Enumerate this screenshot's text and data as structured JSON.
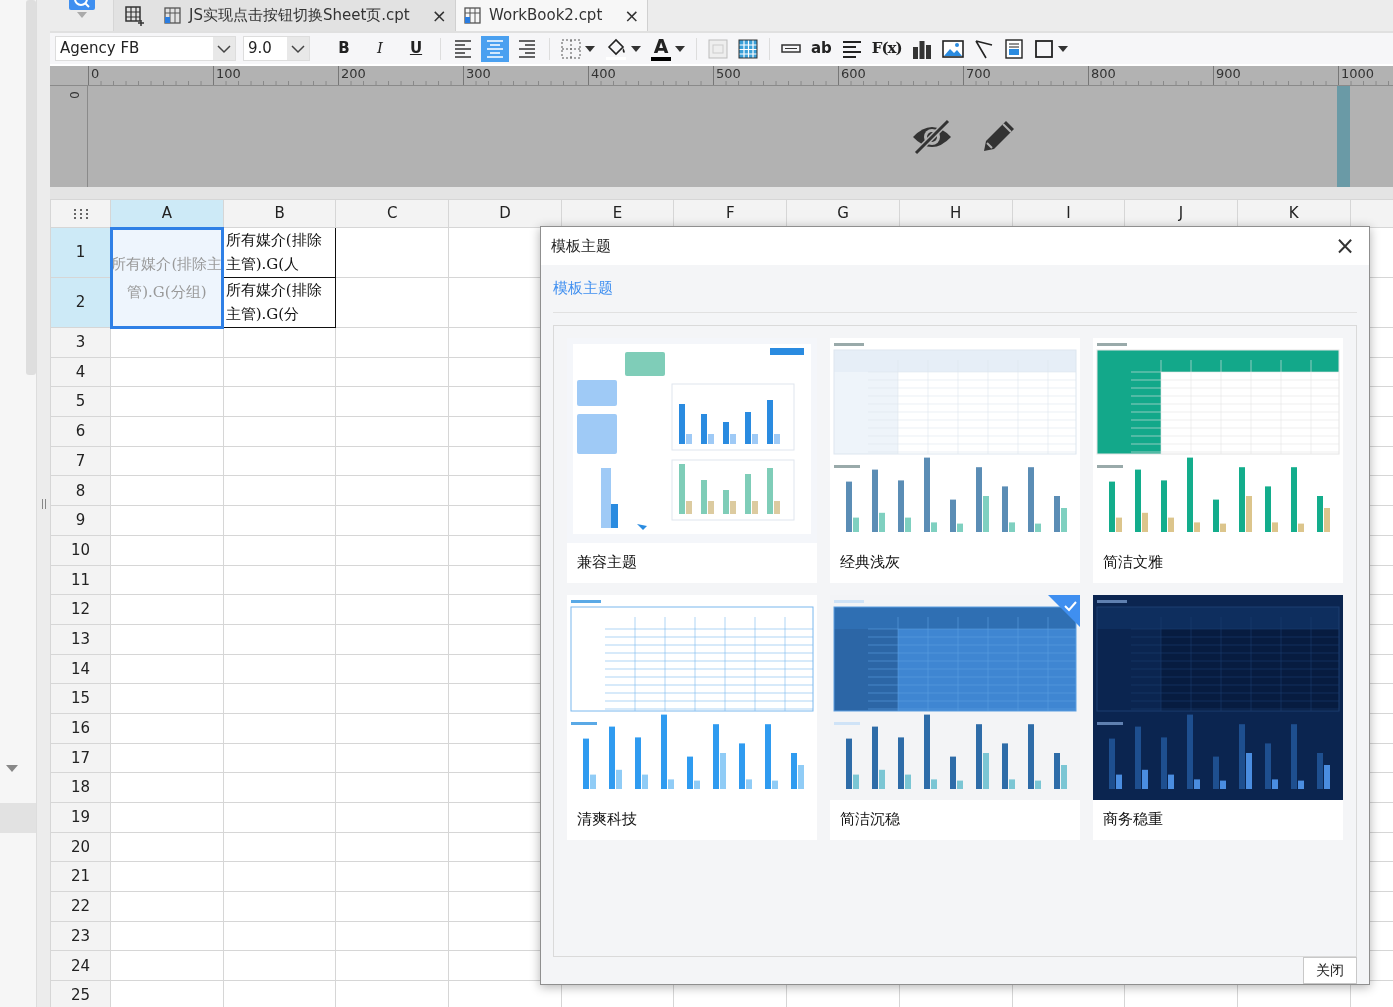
{
  "tabs": [
    {
      "label": "JS实现点击按钮切换Sheet页.cpt",
      "selected": false,
      "close": "×"
    },
    {
      "label": "WorkBook2.cpt",
      "selected": true,
      "close": "×"
    }
  ],
  "toolbar": {
    "font": "Agency FB",
    "size": "9.0",
    "styles": [
      {
        "label": "B",
        "kind": "bold"
      },
      {
        "label": "I",
        "kind": "italic"
      },
      {
        "label": "U",
        "kind": "underline"
      }
    ],
    "alignments": [
      {
        "kind": "left",
        "selected": false
      },
      {
        "kind": "center",
        "selected": true
      },
      {
        "kind": "right",
        "selected": false
      }
    ],
    "font_color_label": "A",
    "text_tool_label": "ab",
    "formula_label": "F(x)"
  },
  "ruler": {
    "marks": [
      "0",
      "100",
      "200",
      "300",
      "400",
      "500",
      "600",
      "700",
      "800",
      "900",
      "1000"
    ],
    "vertical_mark": "0"
  },
  "sheet": {
    "columns": [
      {
        "label": "A",
        "selected": true
      },
      {
        "label": "B",
        "selected": false
      },
      {
        "label": "C",
        "selected": false
      },
      {
        "label": "D",
        "selected": false
      },
      {
        "label": "E",
        "selected": false
      },
      {
        "label": "F",
        "selected": false
      },
      {
        "label": "G",
        "selected": false
      },
      {
        "label": "H",
        "selected": false
      },
      {
        "label": "I",
        "selected": false
      },
      {
        "label": "J",
        "selected": false
      },
      {
        "label": "K",
        "selected": false
      }
    ],
    "rows": [
      {
        "label": "1",
        "selected": true,
        "cells": [
          {
            "kind": "merged",
            "text": "所有媒介(排除主管).G(分组)",
            "selected": true
          },
          {
            "kind": "plain",
            "text": "所有媒介(排除主管).G(人",
            "selected": false
          }
        ]
      },
      {
        "label": "2",
        "selected": true,
        "cells": [
          {
            "kind": "plain",
            "text": "所有媒介(排除主管).G(分",
            "selected": false
          }
        ]
      },
      {
        "label": "3",
        "selected": false
      },
      {
        "label": "4",
        "selected": false
      },
      {
        "label": "5",
        "selected": false
      },
      {
        "label": "6",
        "selected": false
      },
      {
        "label": "7",
        "selected": false
      },
      {
        "label": "8",
        "selected": false
      },
      {
        "label": "9",
        "selected": false
      },
      {
        "label": "10",
        "selected": false
      },
      {
        "label": "11",
        "selected": false
      },
      {
        "label": "12",
        "selected": false
      },
      {
        "label": "13",
        "selected": false
      },
      {
        "label": "14",
        "selected": false
      },
      {
        "label": "15",
        "selected": false
      },
      {
        "label": "16",
        "selected": false
      },
      {
        "label": "17",
        "selected": false
      },
      {
        "label": "18",
        "selected": false
      },
      {
        "label": "19",
        "selected": false
      },
      {
        "label": "20",
        "selected": false
      },
      {
        "label": "21",
        "selected": false
      },
      {
        "label": "22",
        "selected": false
      },
      {
        "label": "23",
        "selected": false
      },
      {
        "label": "24",
        "selected": false
      },
      {
        "label": "25",
        "selected": false
      }
    ]
  },
  "dialog": {
    "title": "模板主题",
    "close": "×",
    "tab": "模板主题",
    "themes": [
      {
        "name": "兼容主题",
        "kind": "illustration",
        "selected": false
      },
      {
        "name": "经典浅灰",
        "kind": "gray",
        "selected": false
      },
      {
        "name": "简洁文雅",
        "kind": "green",
        "selected": false
      },
      {
        "name": "清爽科技",
        "kind": "light",
        "selected": false
      },
      {
        "name": "简洁沉稳",
        "kind": "blue",
        "selected": true
      },
      {
        "name": "商务稳重",
        "kind": "dark",
        "selected": false
      }
    ],
    "button": "关闭"
  }
}
